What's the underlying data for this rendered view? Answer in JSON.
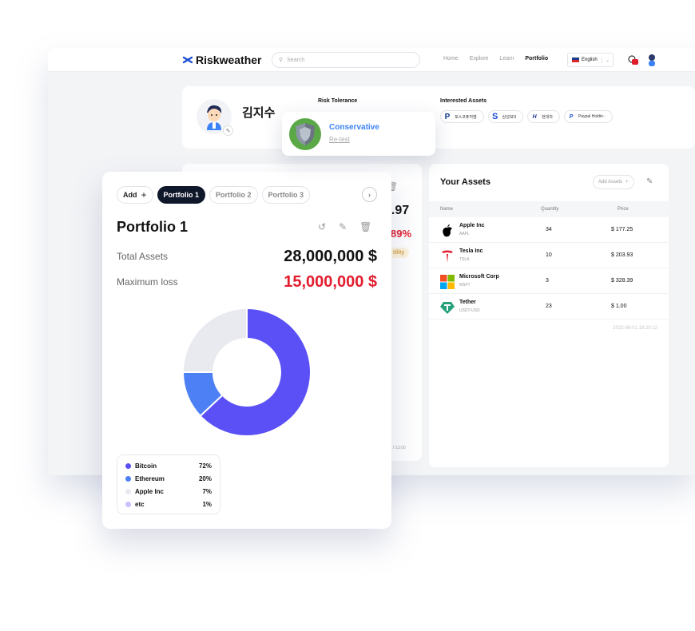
{
  "nav": {
    "logo": "Riskweather",
    "search_placeholder": "Search",
    "links": [
      "Home",
      "Explore",
      "Learn",
      "Portfolio"
    ],
    "active_link": "Portfolio",
    "language": "English"
  },
  "profile": {
    "username": "김지수",
    "risk_tolerance_label": "Risk Tolerance",
    "interested_assets_label": "Interested Assets",
    "interested_assets": [
      "포스코퓨처엠",
      "삼성SDI",
      "현대차",
      "Paypal Holdin··"
    ]
  },
  "risk_popup": {
    "title": "Conservative",
    "retest": "Re-test"
  },
  "background_portfolio": {
    "value_partial": "3.97",
    "percent_partial": "89%",
    "tag_partial": "tility",
    "timestamp_partial": "1 17:13:00"
  },
  "assets": {
    "title": "Your Assets",
    "add_label": "Add Assets",
    "columns": [
      "Name",
      "Quantity",
      "Price"
    ],
    "rows": [
      {
        "name": "Apple Inc",
        "ticker": "AAPL",
        "quantity": "34",
        "price": "$ 177.25"
      },
      {
        "name": "Tesla Inc",
        "ticker": "TSLA",
        "quantity": "10",
        "price": "$ 203.93"
      },
      {
        "name": "Microsoft Corp",
        "ticker": "MSFT",
        "quantity": "3",
        "price": "$ 328.39"
      },
      {
        "name": "Tether",
        "ticker": "USDT-USD",
        "quantity": "23",
        "price": "$ 1.00"
      }
    ],
    "timestamp": "2023-08-01 18:20:12"
  },
  "portfolio": {
    "add_label": "Add",
    "tabs": [
      "Portfolio 1",
      "Portfolio 2",
      "Portfolio 3"
    ],
    "active_tab": "Portfolio 1",
    "title": "Portfolio 1",
    "total_assets_label": "Total Assets",
    "total_assets_value": "28,000,000 $",
    "max_loss_label": "Maximum loss",
    "max_loss_value": "15,000,000 $",
    "allocation": [
      {
        "name": "Bitcoin",
        "percent": 72,
        "label": "72%",
        "color": "#5a50f5"
      },
      {
        "name": "Ethereum",
        "percent": 20,
        "label": "20%",
        "color": "#4d80f5"
      },
      {
        "name": "Apple Inc",
        "percent": 7,
        "label": "7%",
        "color": "#e9eaef"
      },
      {
        "name": "etc",
        "percent": 1,
        "label": "1%",
        "color": "#c9c0ff"
      }
    ],
    "donut_shares": [
      {
        "name": "Bitcoin",
        "fraction": 0.63,
        "color": "#5a50f5"
      },
      {
        "name": "Ethereum",
        "fraction": 0.12,
        "color": "#4d80f5"
      },
      {
        "name": "Apple Inc",
        "fraction": 0.25,
        "color": "#e9eaef"
      }
    ]
  },
  "colors": {
    "accent": "#0f172a",
    "loss": "#e11d2e",
    "link": "#3b82f6"
  }
}
